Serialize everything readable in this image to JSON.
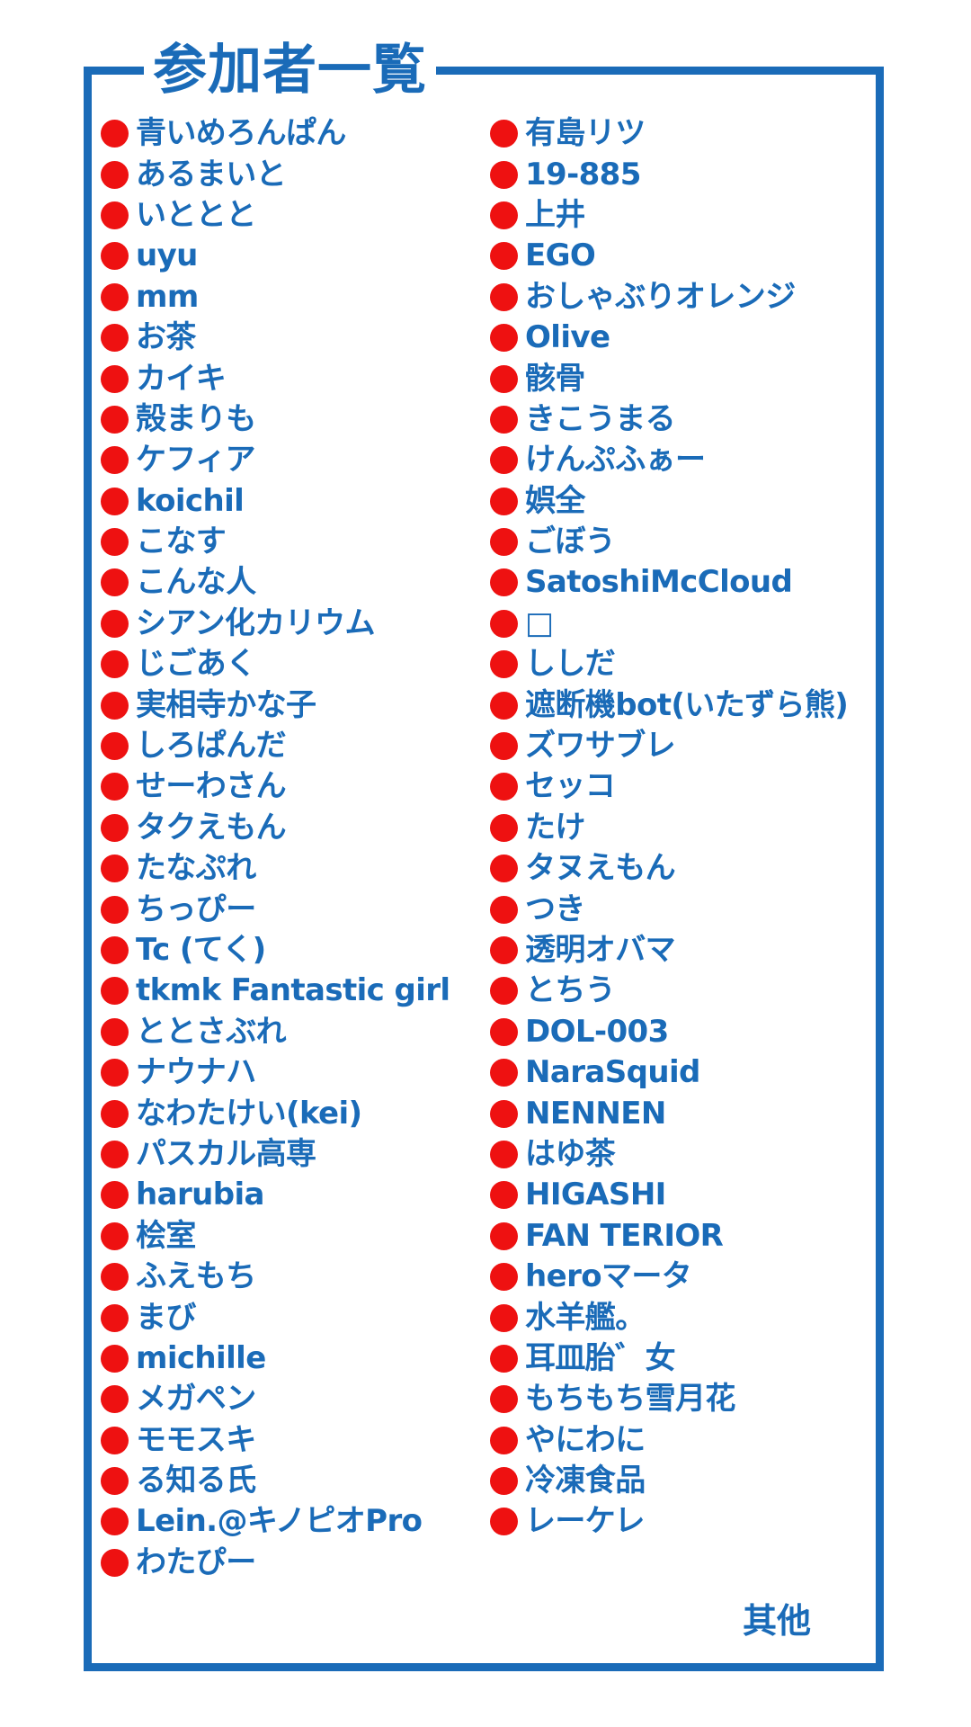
{
  "title": "参加者一覧",
  "bullet_color": "#ee1111",
  "text_color": "#1a6bb8",
  "frame_color": "#1a6bb8",
  "participants_left": [
    "青いめろんぱん",
    "あるまいと",
    "いととと",
    "uyu",
    "mm",
    "お茶",
    "カイキ",
    "殻まりも",
    "ケフィア",
    "koichil",
    "こなす",
    "こんな人",
    "シアン化カリウム",
    "じごあく",
    "実相寺かな子",
    "しろぱんだ",
    "せーわさん",
    "タクえもん",
    "たなぷれ",
    "ちっぴー",
    "Tc (てく)",
    "tkmk Fantastic girl",
    "ととさぶれ",
    "ナウナハ",
    "なわたけい(kei)",
    "パスカル高専",
    "harubia",
    "桧室",
    "ふえもち",
    "まび",
    "michille",
    "メガペン",
    "モモスキ",
    "る知る氏",
    "Lein.@キノピオPro",
    "わたぴー"
  ],
  "participants_right": [
    "有島リツ",
    "19-885",
    "上井",
    "EGO",
    "おしゃぶりオレンジ",
    "Olive",
    "骸骨",
    "きこうまる",
    "けんぷふぁー",
    "娯全",
    "ごぼう",
    "SatoshiMcCloud",
    "□",
    "ししだ",
    "遮断機bot(いたずら熊)",
    "ズワサブレ",
    "セッコ",
    "たけ",
    "タヌえもん",
    "つき",
    "透明オバマ",
    "とちう",
    "DOL-003",
    "NaraSquid",
    "NENNEN",
    "はゆ茶",
    "HIGASHI",
    "FAN TERIOR",
    "heroマータ",
    "水羊艦。",
    "耳皿胎゛女",
    "もちもち雪月花",
    "やにわに",
    "冷凍食品",
    "レーケレ"
  ],
  "other_label": "其他"
}
